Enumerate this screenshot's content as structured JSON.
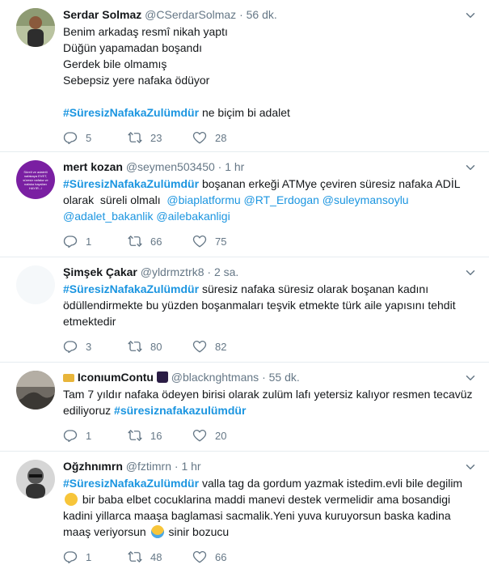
{
  "tweets": [
    {
      "name": "Serdar Solmaz",
      "handle": "@CSerdarSolmaz",
      "sep": "·",
      "time": "56 dk.",
      "lines": [
        "Benim arkadaş resmî nikah yaptı",
        "Düğün yapamadan boşandı",
        "Gerdek bile olmamış",
        "Sebepsiz yere nafaka ödüyor"
      ],
      "hashtag": "#SüresizNafakaZulümdür",
      "after_hashtag": " ne biçim bi adalet",
      "replies": "5",
      "retweets": "23",
      "likes": "28"
    },
    {
      "name": "mert kozan",
      "handle": "@seymen503450",
      "sep": "·",
      "time": "1 hr",
      "hashtag": "#SüresizNafakaZulümdür",
      "text_a": " boşanan erkeği ATMye çeviren süresiz nafaka ADİL olarak  süreli olmalı  ",
      "mentions": [
        "@biaplatformu",
        "@RT_Erdogan",
        "@suleymansoylu",
        "@adalet_bakanlik",
        "@ailebakanligi"
      ],
      "avatar_text": "Süreli ve adaletli nafakaya EVET, süresiz nafaka ve nafaka haysiları HAYIR...!",
      "replies": "1",
      "retweets": "66",
      "likes": "75"
    },
    {
      "name": "Şimşek Çakar",
      "handle": "@yldrmztrk8",
      "sep": "·",
      "time": "2 sa.",
      "hashtag": "#SüresizNafakaZulümdür",
      "text_a": " süresiz nafaka süresiz olarak boşanan kadını ödüllendirmekte bu yüzden boşanmaları teşvik etmekte türk aile yapısını tehdit etmektedir",
      "replies": "3",
      "retweets": "80",
      "likes": "82"
    },
    {
      "name": "IconıumContu",
      "handle": "@blacknghtmans",
      "sep": "·",
      "time": "55 dk.",
      "text_a": "Tam 7 yıldır nafaka ödeyen birisi olarak zulüm lafı yetersiz kalıyor resmen tecavüz ediliyoruz ",
      "hashtag": "#süresiznafakazulümdür",
      "replies": "1",
      "retweets": "16",
      "likes": "20"
    },
    {
      "name": "Oğzhnımrn",
      "handle": "@fztimrn",
      "sep": "·",
      "time": "1 hr",
      "hashtag": "#SüresizNafakaZulümdür",
      "text_a": " valla tag da gordum yazmak istedim.evli bile degilim ",
      "text_b": " bir baba elbet cocuklarina maddi manevi destek vermelidir ama bosandigi kadini yillarca maaşa baglamasi sacmalik.Yeni yuva kuruyorsun baska kadina maaş veriyorsun ",
      "text_c": " sinir bozucu",
      "replies": "1",
      "retweets": "48",
      "likes": "66"
    }
  ],
  "icons": {
    "reply": "reply-icon",
    "retweet": "retweet-icon",
    "like": "heart-icon",
    "caret": "chevron-down-icon"
  },
  "colors": {
    "link": "#1b95e0",
    "muted": "#657786",
    "border": "#e6ecf0"
  }
}
